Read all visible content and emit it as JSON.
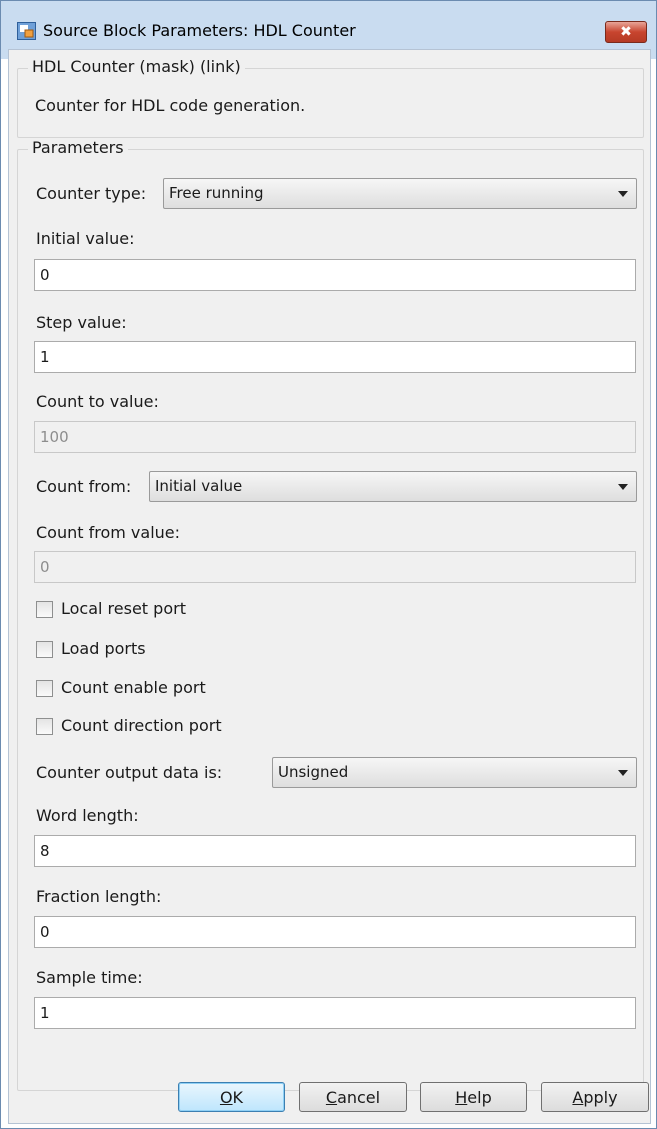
{
  "window": {
    "title": "Source Block Parameters: HDL Counter",
    "close_glyph": "✖",
    "icon": "simulink-block-icon"
  },
  "description_group": {
    "label": "HDL Counter (mask) (link)",
    "text": "Counter for HDL code generation."
  },
  "parameters": {
    "label": "Parameters",
    "counter_type": {
      "label": "Counter type:",
      "value": "Free running"
    },
    "initial_value": {
      "label": "Initial value:",
      "value": "0"
    },
    "step_value": {
      "label": "Step value:",
      "value": "1"
    },
    "count_to_value": {
      "label": "Count to value:",
      "value": "100"
    },
    "count_from": {
      "label": "Count from:",
      "value": "Initial value"
    },
    "count_from_value": {
      "label": "Count from value:",
      "value": "0"
    },
    "checkboxes": [
      {
        "label": "Local reset port",
        "checked": false
      },
      {
        "label": "Load ports",
        "checked": false
      },
      {
        "label": "Count enable port",
        "checked": false
      },
      {
        "label": "Count direction port",
        "checked": false
      }
    ],
    "output_data": {
      "label": "Counter output data is:",
      "value": "Unsigned"
    },
    "word_length": {
      "label": "Word length:",
      "value": "8"
    },
    "fraction_length": {
      "label": "Fraction length:",
      "value": "0"
    },
    "sample_time": {
      "label": "Sample time:",
      "value": "1"
    }
  },
  "buttons": {
    "ok": {
      "mnemonic": "O",
      "rest": "K"
    },
    "cancel": {
      "mnemonic": "C",
      "rest": "ancel"
    },
    "help": {
      "mnemonic": "H",
      "rest": "elp"
    },
    "apply": {
      "mnemonic": "A",
      "rest": "pply"
    }
  }
}
